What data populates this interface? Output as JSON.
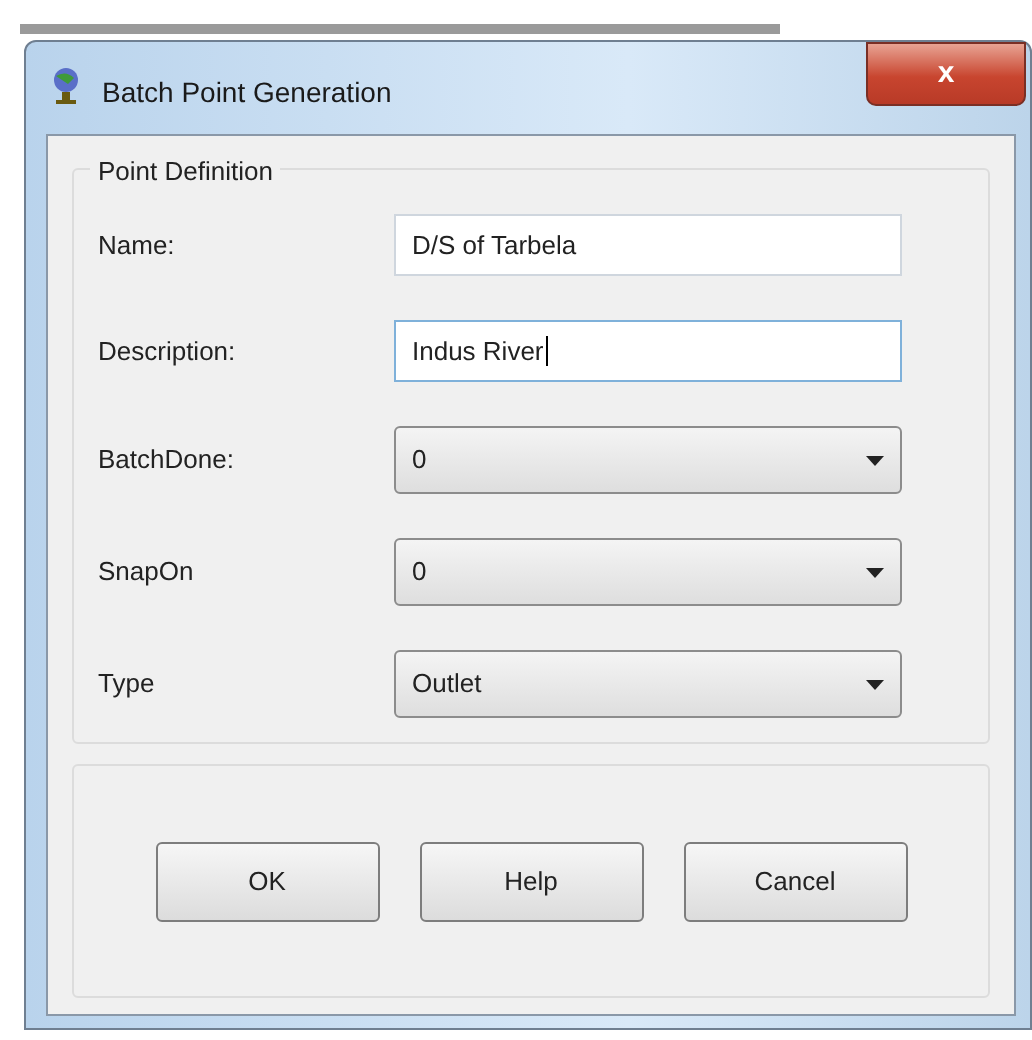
{
  "window": {
    "title": "Batch Point Generation",
    "close": "x"
  },
  "group": {
    "title": "Point Definition"
  },
  "fields": [
    {
      "label": "Name:",
      "kind": "text",
      "value": "D/S of Tarbela",
      "focused": false
    },
    {
      "label": "Description:",
      "kind": "text",
      "value": "Indus River",
      "focused": true
    },
    {
      "label": "BatchDone:",
      "kind": "dropdown",
      "value": "0",
      "focused": false
    },
    {
      "label": "SnapOn",
      "kind": "dropdown",
      "value": "0",
      "focused": false
    },
    {
      "label": "Type",
      "kind": "dropdown",
      "value": "Outlet",
      "focused": false
    }
  ],
  "buttons": [
    "OK",
    "Help",
    "Cancel"
  ]
}
